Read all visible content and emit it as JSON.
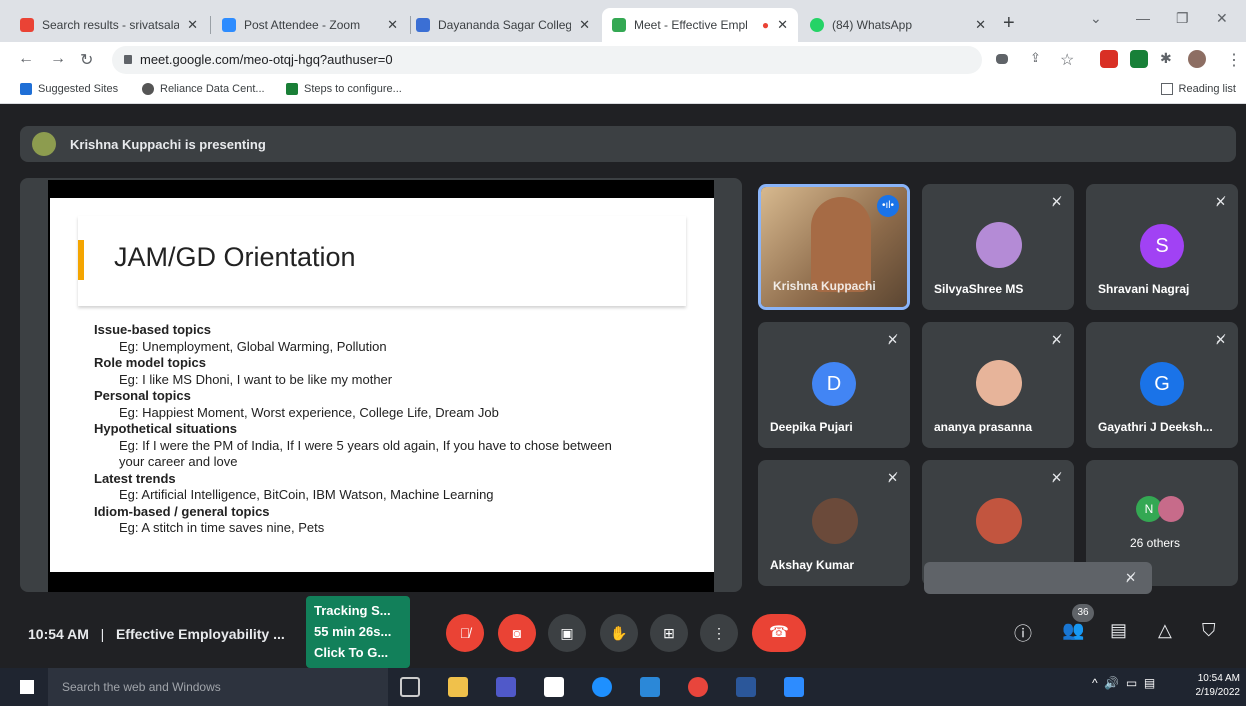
{
  "browser": {
    "tabs": [
      {
        "title": "Search results - srivatsala",
        "color": "#ea4335"
      },
      {
        "title": "Post Attendee - Zoom",
        "color": "#2d8cff"
      },
      {
        "title": "Dayananda Sagar College",
        "color": "#3b6fd4"
      },
      {
        "title": "Meet - Effective Empl",
        "color": "#34a853"
      },
      {
        "title": "(84) WhatsApp",
        "color": "#25d366"
      }
    ],
    "new_tab": "+",
    "url": "meet.google.com/meo-otqj-hgq?authuser=0",
    "bookmarks": [
      {
        "label": "Suggested Sites",
        "color": "#1f6fd6"
      },
      {
        "label": "Reliance Data Cent...",
        "color": "#555"
      },
      {
        "label": "Steps to configure...",
        "color": "#1a7f37"
      }
    ],
    "reading_list": "Reading list"
  },
  "meet": {
    "presenting_banner": "Krishna Kuppachi is presenting",
    "slide": {
      "title": "JAM/GD Orientation",
      "lines": [
        {
          "kind": "h",
          "text": "Issue-based topics"
        },
        {
          "kind": "e",
          "text": "Eg: Unemployment, Global Warming, Pollution"
        },
        {
          "kind": "h",
          "text": "Role model topics"
        },
        {
          "kind": "e",
          "text": "Eg: I like MS Dhoni, I want to be like my mother"
        },
        {
          "kind": "h",
          "text": "Personal topics"
        },
        {
          "kind": "e",
          "text": "Eg: Happiest Moment, Worst experience, College Life, Dream Job"
        },
        {
          "kind": "h",
          "text": "Hypothetical situations"
        },
        {
          "kind": "e",
          "text": "Eg: If I were the PM of India, If I were 5 years old again, If you have to chose between"
        },
        {
          "kind": "e",
          "text": "your career and love"
        },
        {
          "kind": "h",
          "text": "Latest trends"
        },
        {
          "kind": "e",
          "text": "Eg: Artificial Intelligence, BitCoin, IBM Watson, Machine Learning"
        },
        {
          "kind": "h",
          "text": "Idiom-based / general topics"
        },
        {
          "kind": "e",
          "text": "Eg: A stitch in time saves nine, Pets"
        }
      ]
    },
    "participants": [
      {
        "name": "Krishna Kuppachi",
        "type": "video"
      },
      {
        "name": "SilvyaShree MS",
        "type": "photo",
        "color": "#b48bd6"
      },
      {
        "name": "Shravani Nagraj",
        "type": "initial",
        "initial": "S",
        "color": "#a142f4"
      },
      {
        "name": "Deepika Pujari",
        "type": "initial",
        "initial": "D",
        "color": "#4285f4"
      },
      {
        "name": "ananya prasanna",
        "type": "photo",
        "color": "#e7b49a"
      },
      {
        "name": "Gayathri J Deeksh...",
        "type": "initial",
        "initial": "G",
        "color": "#1a73e8"
      },
      {
        "name": "Akshay Kumar",
        "type": "photo",
        "color": "#6b4a3a"
      },
      {
        "name": "",
        "type": "photo",
        "color": "#c2553f"
      },
      {
        "name": "26 others",
        "type": "others"
      }
    ],
    "others_initial": "N",
    "time": "10:54 AM",
    "separator": "|",
    "meeting_title": "Effective Employability ...",
    "tracking": [
      "Tracking S...",
      "55 min 26s...",
      "Click To G..."
    ],
    "participant_count": "36"
  },
  "taskbar": {
    "search_placeholder": "Search the web and Windows",
    "time": "10:54 AM",
    "date": "2/19/2022"
  }
}
